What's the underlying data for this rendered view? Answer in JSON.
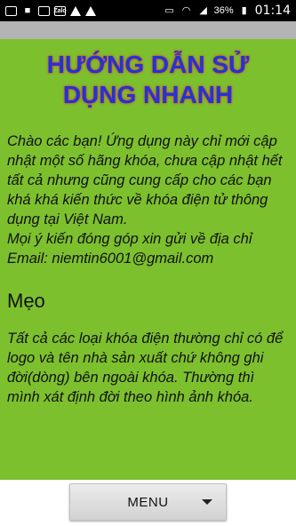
{
  "status_bar": {
    "left_icons": [
      "email-icon",
      "video-icon",
      "chat-icon",
      "zalo-icon",
      "warning-icon",
      "warning-icon"
    ],
    "zalo_label": "Zalo",
    "right_icons": [
      "cast-icon",
      "wifi-icon",
      "signal-icon",
      "battery-icon"
    ],
    "battery": "36%",
    "time": "01:14"
  },
  "page": {
    "title": "HƯỚNG DẪN SỬ DỤNG NHANH",
    "intro": "Chào các bạn! Ứng dụng này chỉ mới cập nhật một số hãng khóa, chưa cập nhật hết tất cả nhưng cũng cung cấp cho các bạn khá khá kiến thức về khóa điện tử thông dụng tại Việt Nam.",
    "contact": "Mọi ý kiến đóng góp xin gửi về địa chỉ Email: niemtin6001@gmail.com",
    "section_heading": "Mẹo",
    "tip": "Tất cả các loại khóa điện thường chỉ có để logo và tên nhà sản xuất chứ không ghi đời(dòng) bên ngoài khóa. Thường thì mình xát định đời theo hình ảnh khóa."
  },
  "menu": {
    "label": "MENU"
  },
  "colors": {
    "background": "#7dc02e",
    "title": "#2134d6",
    "title_glow": "#e0342a",
    "app_bar": "#b4b4b4"
  }
}
